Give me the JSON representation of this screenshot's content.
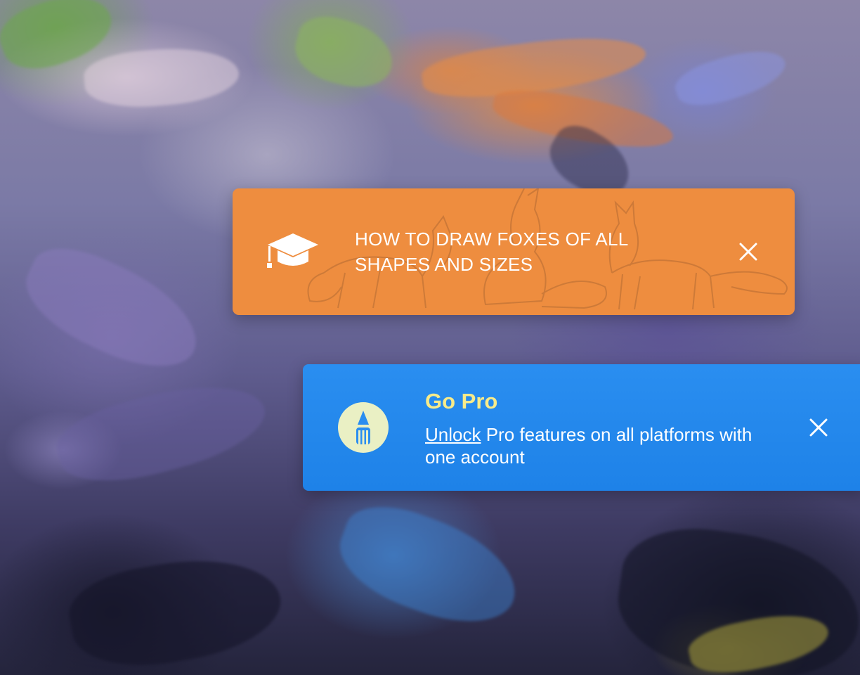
{
  "course_notification": {
    "title": "HOW TO DRAW FOXES OF ALL SHAPES AND SIZES",
    "icon": "graduation-cap-icon",
    "close_icon": "close-icon",
    "background_color": "#ee8d3f"
  },
  "pro_notification": {
    "title": "Go Pro",
    "link_text": "Unlock",
    "body_text": " Pro features on all platforms with one account",
    "icon": "pencil-icon",
    "close_icon": "close-icon",
    "background_color": "#2a8ef0",
    "title_color": "#f7eb8a"
  }
}
